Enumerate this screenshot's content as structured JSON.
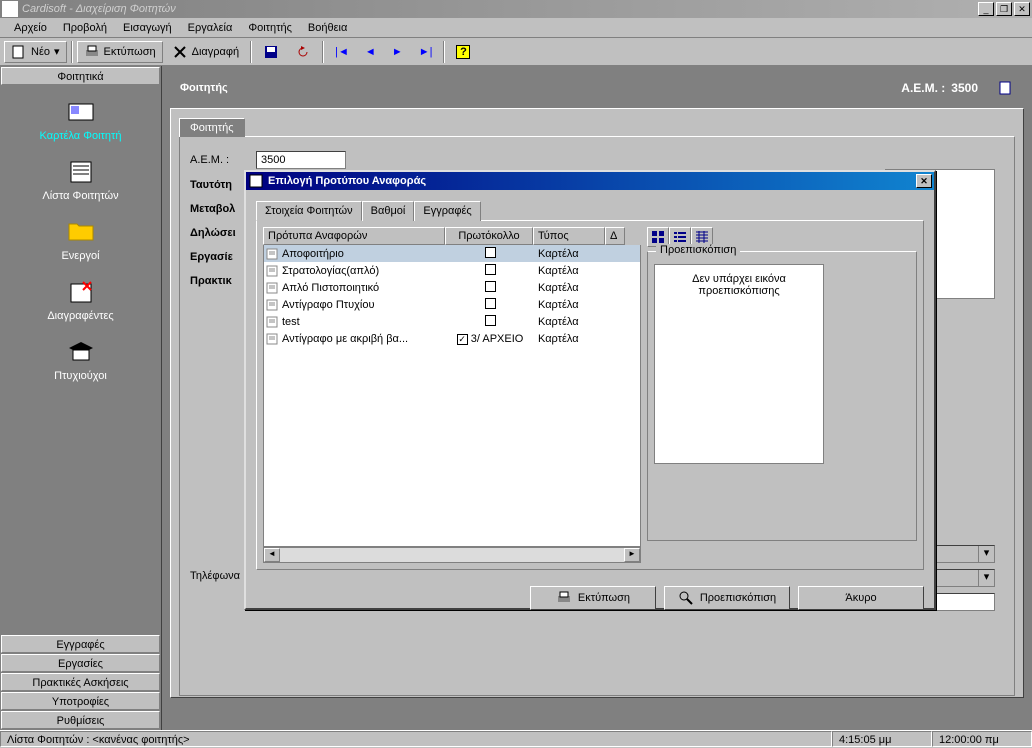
{
  "window": {
    "title": "Cardisoft - Διαχείριση Φοιτητών"
  },
  "menu": [
    "Αρχείο",
    "Προβολή",
    "Εισαγωγή",
    "Εργαλεία",
    "Φοιτητής",
    "Βοήθεια"
  ],
  "toolbar": {
    "new": "Νέο",
    "print": "Εκτύπωση",
    "delete": "Διαγραφή"
  },
  "sidebar": {
    "header": "Φοιτητικά",
    "items": [
      {
        "label": "Καρτέλα Φοιτητή",
        "active": true
      },
      {
        "label": "Λίστα Φοιτητών"
      },
      {
        "label": "Ενεργοί"
      },
      {
        "label": "Διαγραφέντες"
      },
      {
        "label": "Πτυχιούχοι"
      }
    ],
    "bottoms": [
      "Εγγραφές",
      "Εργασίες",
      "Πρακτικές Ασκήσεις",
      "Υποτροφίες",
      "Ρυθμίσεις"
    ]
  },
  "content": {
    "title": "Φοιτητής",
    "aem_label": "Α.Ε.Μ. :",
    "aem_value": "3500",
    "tabs": {
      "t0": "Φοιτητής",
      "sections": [
        "Ταυτότη",
        "Μεταβολ",
        "Δηλώσει",
        "Εργασίε",
        "Πρακτικ"
      ]
    },
    "form": {
      "aem_lbl": "Α.Ε.Μ. :",
      "aem_val": "3500",
      "tel_lbl": "Τηλέφωνα :"
    }
  },
  "modal": {
    "title": "Επιλογή Προτύπου Αναφοράς",
    "tabs": [
      "Στοιχεία Φοιτητών",
      "Βαθμοί",
      "Εγγραφές"
    ],
    "cols": [
      "Πρότυπα Αναφορών",
      "Πρωτόκολλο",
      "Τύπος",
      "Δ"
    ],
    "rows": [
      {
        "name": "Αποφοιτήριο",
        "checked": false,
        "proto": "",
        "type": "Καρτέλα",
        "sel": true
      },
      {
        "name": "Στρατολογίας(απλό)",
        "checked": false,
        "proto": "",
        "type": "Καρτέλα"
      },
      {
        "name": "Απλό Πιστοποιητικό",
        "checked": false,
        "proto": "",
        "type": "Καρτέλα"
      },
      {
        "name": "Αντίγραφο Πτυχίου",
        "checked": false,
        "proto": "",
        "type": "Καρτέλα"
      },
      {
        "name": "test",
        "checked": false,
        "proto": "",
        "type": "Καρτέλα"
      },
      {
        "name": "Αντίγραφο με ακριβή βα...",
        "checked": true,
        "proto": "3/ ΑΡΧΕΙΟ",
        "type": "Καρτέλα"
      }
    ],
    "preview_legend": "Προεπισκόπιση",
    "preview_empty1": "Δεν υπάρχει εικόνα",
    "preview_empty2": "προεπισκόπισης",
    "btn_print": "Εκτύπωση",
    "btn_preview": "Προεπισκόπιση",
    "btn_cancel": "Άκυρο"
  },
  "status": {
    "list": "Λίστα Φοιτητών : <κανένας φοιτητής>",
    "time1": "4:15:05 μμ",
    "time2": "12:00:00 πμ"
  }
}
